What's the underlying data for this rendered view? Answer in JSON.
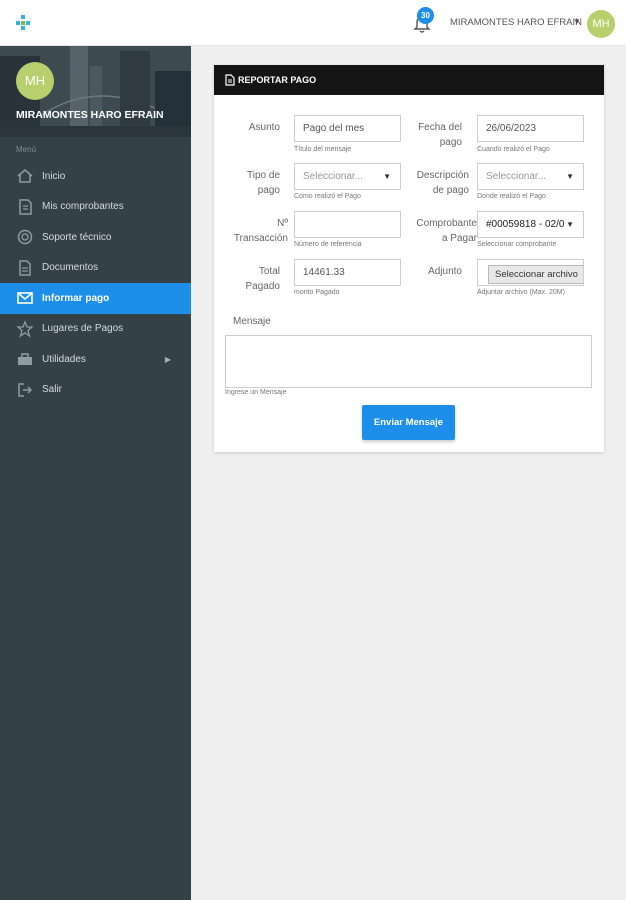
{
  "topbar": {
    "notifications_count": "30",
    "user_name": "MIRAMONTES HARO EFRAIN",
    "user_caret": "▼",
    "avatar_initials": "MH"
  },
  "sidebar": {
    "avatar_initials": "MH",
    "user_name": "MIRAMONTES HARO EFRAIN",
    "menu_title": "Menú",
    "items": [
      {
        "label": "Inicio",
        "icon": "home-icon",
        "active": false
      },
      {
        "label": "Mis comprobantes",
        "icon": "receipt-icon",
        "active": false
      },
      {
        "label": "Soporte técnico",
        "icon": "lifebuoy-icon",
        "active": false
      },
      {
        "label": "Documentos",
        "icon": "document-icon",
        "active": false
      },
      {
        "label": "Informar pago",
        "icon": "envelope-icon",
        "active": true
      },
      {
        "label": "Lugares de Pagos",
        "icon": "star-icon",
        "active": false
      },
      {
        "label": "Utilidades",
        "icon": "toolbox-icon",
        "active": false,
        "arrow": "▶"
      },
      {
        "label": "Salir",
        "icon": "logout-icon",
        "active": false
      }
    ]
  },
  "form": {
    "title": "REPORTAR PAGO",
    "asunto": {
      "label": "Asunto",
      "value": "Pago del mes",
      "help": "Título del mensaje"
    },
    "fecha": {
      "label": "Fecha del pago",
      "value": "26/06/2023",
      "help": "Cuando realizó el Pago"
    },
    "tipo": {
      "label": "Tipo de pago",
      "placeholder": "Seleccionar...",
      "help": "Como realizó el Pago"
    },
    "descripcion": {
      "label": "Descripción de pago",
      "placeholder": "Seleccionar...",
      "help": "Donde realizó el Pago"
    },
    "transaccion": {
      "label": "Nº Transacción",
      "value": "",
      "help": "Número de referencia"
    },
    "comprobante": {
      "label": "Comprobante a Pagar",
      "value": "#00059818 - 02/0",
      "help": "Seleccionar comprobante"
    },
    "total": {
      "label": "Total Pagado",
      "value": "14461.33",
      "help": "monto Pagado"
    },
    "adjunto": {
      "label": "Adjunto",
      "button": "Seleccionar archivo",
      "help": "Adjuntar archivo (Max. 20M)"
    },
    "mensaje": {
      "label": "Mensaje",
      "help": "Ingrese un Mensaje"
    },
    "submit": "Enviar Mensaje"
  },
  "colors": {
    "accent": "#1e8fe8",
    "sidebar_bg": "#344248",
    "avatar": "#b8cf6e",
    "card_header": "#141414"
  }
}
